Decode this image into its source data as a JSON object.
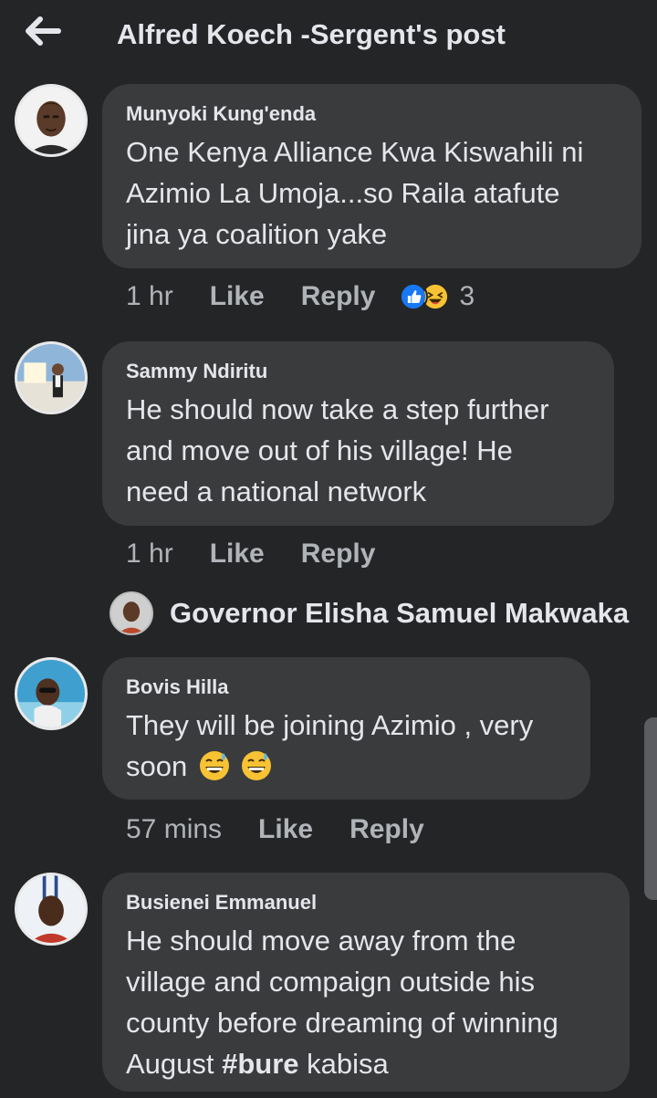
{
  "header": {
    "title": "Alfred Koech -Sergent's post"
  },
  "comments": [
    {
      "author": "Munyoki Kung'enda",
      "lines": [
        "One Kenya Alliance Kwa Kiswahili ni",
        "Azimio La Umoja...so Raila atafute",
        "jina ya coalition yake"
      ],
      "time": "1 hr",
      "like": "Like",
      "reply": "Reply",
      "reaction_count": "3"
    },
    {
      "author": "Sammy Ndiritu",
      "lines": [
        "He should now take a step further",
        "and move out of his village! He",
        "need a national network"
      ],
      "time": "1 hr",
      "like": "Like",
      "reply": "Reply"
    },
    {
      "author": "Bovis Hilla",
      "lines": [
        "They will be joining Azimio , very",
        "soon"
      ],
      "time": "57 mins",
      "like": "Like",
      "reply": "Reply"
    },
    {
      "author": "Busienei Emmanuel",
      "lines": [
        "He should move away from the",
        "village and compaign outside his",
        "county before dreaming of winning"
      ],
      "last_line_prefix": "August ",
      "last_line_hashtag": "#bure",
      "last_line_suffix": " kabisa"
    }
  ],
  "reply_preview": {
    "name": "Governor Elisha Samuel Makwaka"
  },
  "icons": {
    "back": "arrow-left-icon",
    "reactions": [
      "like-reaction-icon",
      "haha-reaction-icon"
    ],
    "emoji": "grinning-sweat-emoji"
  },
  "colors": {
    "background": "#242526",
    "bubble": "#3a3b3c",
    "like_blue": "#1877f2",
    "haha_yellow": "#f7c233"
  }
}
